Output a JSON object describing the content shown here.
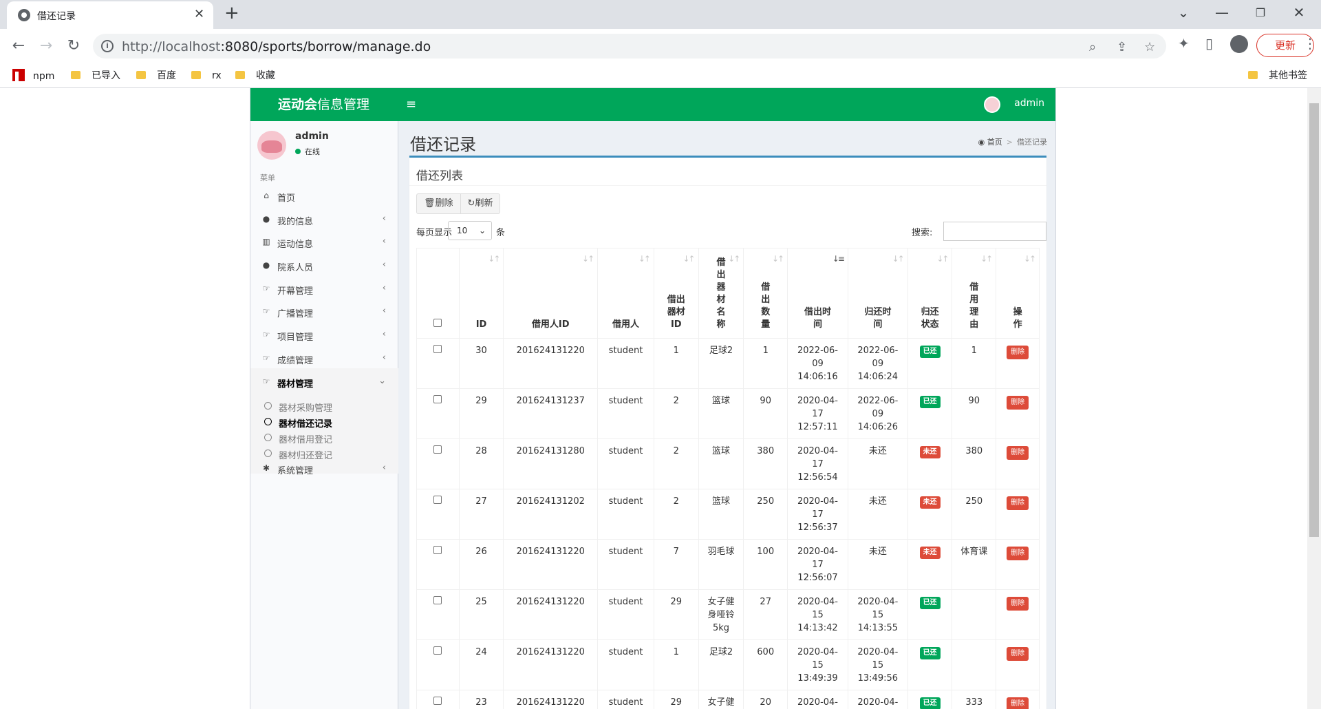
{
  "browser": {
    "tab_title": "借还记录",
    "url_host": "http://localhost",
    "url_rest": ":8080/sports/borrow/manage.do",
    "update_label": "更新",
    "bookmarks": [
      "npm",
      "已导入",
      "百度",
      "rx",
      "收藏"
    ],
    "other_bookmarks": "其他书签"
  },
  "header": {
    "logo_bold": "运动会",
    "logo_rest": "信息管理",
    "user": "admin"
  },
  "sidebar": {
    "user_name": "admin",
    "status": "在线",
    "section": "菜单",
    "items": [
      {
        "label": "首页",
        "icon": "home-icon"
      },
      {
        "label": "我的信息",
        "icon": "user-icon"
      },
      {
        "label": "运动信息",
        "icon": "bar-chart-icon"
      },
      {
        "label": "院系人员",
        "icon": "users-icon"
      },
      {
        "label": "开幕管理",
        "icon": "hand-pointer-icon"
      },
      {
        "label": "广播管理",
        "icon": "hand-pointer-icon"
      },
      {
        "label": "项目管理",
        "icon": "hand-pointer-icon"
      },
      {
        "label": "成绩管理",
        "icon": "hand-pointer-icon"
      },
      {
        "label": "器材管理",
        "icon": "hand-pointer-icon"
      },
      {
        "label": "系统管理",
        "icon": "gear-icon"
      }
    ],
    "sub_items": [
      "器材采购管理",
      "器材借还记录",
      "器材借用登记",
      "器材归还登记"
    ]
  },
  "content": {
    "page_title": "借还记录",
    "breadcrumb_home": "首页",
    "breadcrumb_current": "借还记录",
    "box_title": "借还列表",
    "btn_delete": "删除",
    "btn_refresh": "刷新",
    "length_prefix": "每页显示",
    "length_value": "10",
    "length_suffix": "条",
    "search_label": "搜索:"
  },
  "table": {
    "headers": [
      "ID",
      "借用人ID",
      "借用人",
      "借出\n器材\nID",
      "借\n出\n器\n材\n名\n称",
      "借\n出\n数\n量",
      "借出时\n间",
      "归还时\n间",
      "归还\n状态",
      "借\n用\n理\n由",
      "操\n作"
    ],
    "status_returned": "已还",
    "status_not_returned": "未还",
    "action_delete": "删除",
    "rows": [
      {
        "id": "30",
        "uid": "201624131220",
        "user": "student",
        "eqid": "1",
        "eqname": "足球2",
        "qty": "1",
        "out": "2022-06-\n09\n14:06:16",
        "back": "2022-06-\n09\n14:06:24",
        "returned": true,
        "reason": "1"
      },
      {
        "id": "29",
        "uid": "201624131237",
        "user": "student",
        "eqid": "2",
        "eqname": "篮球",
        "qty": "90",
        "out": "2020-04-\n17\n12:57:11",
        "back": "2022-06-\n09\n14:06:26",
        "returned": true,
        "reason": "90"
      },
      {
        "id": "28",
        "uid": "201624131280",
        "user": "student",
        "eqid": "2",
        "eqname": "篮球",
        "qty": "380",
        "out": "2020-04-\n17\n12:56:54",
        "back": "未还",
        "returned": false,
        "reason": "380"
      },
      {
        "id": "27",
        "uid": "201624131202",
        "user": "student",
        "eqid": "2",
        "eqname": "篮球",
        "qty": "250",
        "out": "2020-04-\n17\n12:56:37",
        "back": "未还",
        "returned": false,
        "reason": "250"
      },
      {
        "id": "26",
        "uid": "201624131220",
        "user": "student",
        "eqid": "7",
        "eqname": "羽毛球",
        "qty": "100",
        "out": "2020-04-\n17\n12:56:07",
        "back": "未还",
        "returned": false,
        "reason": "体育课"
      },
      {
        "id": "25",
        "uid": "201624131220",
        "user": "student",
        "eqid": "29",
        "eqname": "女子健\n身哑铃\n5kg",
        "qty": "27",
        "out": "2020-04-\n15\n14:13:42",
        "back": "2020-04-\n15\n14:13:55",
        "returned": true,
        "reason": ""
      },
      {
        "id": "24",
        "uid": "201624131220",
        "user": "student",
        "eqid": "1",
        "eqname": "足球2",
        "qty": "600",
        "out": "2020-04-\n15\n13:49:39",
        "back": "2020-04-\n15\n13:49:56",
        "returned": true,
        "reason": ""
      },
      {
        "id": "23",
        "uid": "201624131220",
        "user": "student",
        "eqid": "29",
        "eqname": "女子健",
        "qty": "20",
        "out": "2020-04-",
        "back": "2020-04-",
        "returned": true,
        "reason": "333"
      }
    ]
  }
}
